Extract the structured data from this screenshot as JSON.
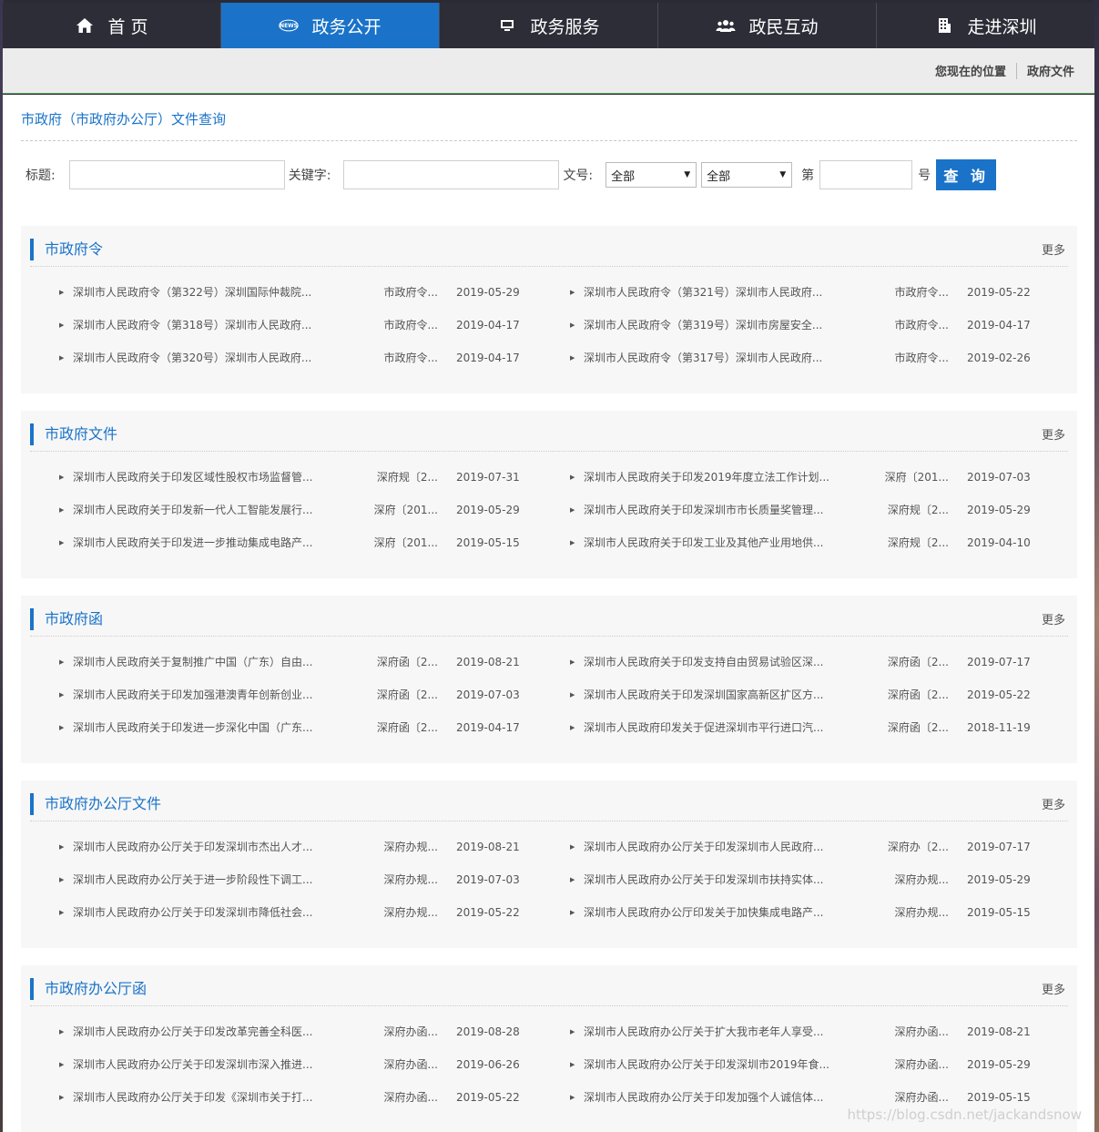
{
  "nav": {
    "items": [
      {
        "label": "首 页"
      },
      {
        "label": "政务公开"
      },
      {
        "label": "政务服务"
      },
      {
        "label": "政民互动"
      },
      {
        "label": "走进深圳"
      }
    ],
    "news_badge": "NEWS"
  },
  "breadcrumb": {
    "prefix": "您现在的位置",
    "current": "政府文件"
  },
  "query": {
    "title": "市政府（市政府办公厅）文件查询",
    "title_label": "标题:",
    "keyword_label": "关键字:",
    "docno_label": "文号:",
    "select1": "全部",
    "select2": "全部",
    "di_label": "第",
    "hao_label": "号",
    "button": "查 询"
  },
  "more_label": "更多",
  "sections": [
    {
      "title": "市政府令",
      "rows": [
        [
          {
            "t": "深圳市人民政府令（第322号）深圳国际仲裁院...",
            "n": "市政府令...",
            "d": "2019-05-29"
          },
          {
            "t": "深圳市人民政府令（第321号）深圳市人民政府...",
            "n": "市政府令...",
            "d": "2019-05-22"
          }
        ],
        [
          {
            "t": "深圳市人民政府令（第318号）深圳市人民政府...",
            "n": "市政府令...",
            "d": "2019-04-17"
          },
          {
            "t": "深圳市人民政府令（第319号）深圳市房屋安全...",
            "n": "市政府令...",
            "d": "2019-04-17"
          }
        ],
        [
          {
            "t": "深圳市人民政府令（第320号）深圳市人民政府...",
            "n": "市政府令...",
            "d": "2019-04-17"
          },
          {
            "t": "深圳市人民政府令（第317号）深圳市人民政府...",
            "n": "市政府令...",
            "d": "2019-02-26"
          }
        ]
      ]
    },
    {
      "title": "市政府文件",
      "rows": [
        [
          {
            "t": "深圳市人民政府关于印发区域性股权市场监督管...",
            "n": "深府规〔2...",
            "d": "2019-07-31"
          },
          {
            "t": "深圳市人民政府关于印发2019年度立法工作计划...",
            "n": "深府〔201...",
            "d": "2019-07-03"
          }
        ],
        [
          {
            "t": "深圳市人民政府关于印发新一代人工智能发展行...",
            "n": "深府〔201...",
            "d": "2019-05-29"
          },
          {
            "t": "深圳市人民政府关于印发深圳市市长质量奖管理...",
            "n": "深府规〔2...",
            "d": "2019-05-29"
          }
        ],
        [
          {
            "t": "深圳市人民政府关于印发进一步推动集成电路产...",
            "n": "深府〔201...",
            "d": "2019-05-15"
          },
          {
            "t": "深圳市人民政府关于印发工业及其他产业用地供...",
            "n": "深府规〔2...",
            "d": "2019-04-10"
          }
        ]
      ]
    },
    {
      "title": "市政府函",
      "rows": [
        [
          {
            "t": "深圳市人民政府关于复制推广中国（广东）自由...",
            "n": "深府函〔2...",
            "d": "2019-08-21"
          },
          {
            "t": "深圳市人民政府关于印发支持自由贸易试验区深...",
            "n": "深府函〔2...",
            "d": "2019-07-17"
          }
        ],
        [
          {
            "t": "深圳市人民政府关于印发加强港澳青年创新创业...",
            "n": "深府函〔2...",
            "d": "2019-07-03"
          },
          {
            "t": "深圳市人民政府关于印发深圳国家高新区扩区方...",
            "n": "深府函〔2...",
            "d": "2019-05-22"
          }
        ],
        [
          {
            "t": "深圳市人民政府关于印发进一步深化中国（广东...",
            "n": "深府函〔2...",
            "d": "2019-04-17"
          },
          {
            "t": "深圳市人民政府印发关于促进深圳市平行进口汽...",
            "n": "深府函〔2...",
            "d": "2018-11-19"
          }
        ]
      ]
    },
    {
      "title": "市政府办公厅文件",
      "rows": [
        [
          {
            "t": "深圳市人民政府办公厅关于印发深圳市杰出人才...",
            "n": "深府办规...",
            "d": "2019-08-21"
          },
          {
            "t": "深圳市人民政府办公厅关于印发深圳市人民政府...",
            "n": "深府办〔2...",
            "d": "2019-07-17"
          }
        ],
        [
          {
            "t": "深圳市人民政府办公厅关于进一步阶段性下调工...",
            "n": "深府办规...",
            "d": "2019-07-03"
          },
          {
            "t": "深圳市人民政府办公厅关于印发深圳市扶持实体...",
            "n": "深府办规...",
            "d": "2019-05-29"
          }
        ],
        [
          {
            "t": "深圳市人民政府办公厅关于印发深圳市降低社会...",
            "n": "深府办规...",
            "d": "2019-05-22"
          },
          {
            "t": "深圳市人民政府办公厅印发关于加快集成电路产...",
            "n": "深府办规...",
            "d": "2019-05-15"
          }
        ]
      ]
    },
    {
      "title": "市政府办公厅函",
      "rows": [
        [
          {
            "t": "深圳市人民政府办公厅关于印发改革完善全科医...",
            "n": "深府办函...",
            "d": "2019-08-28"
          },
          {
            "t": "深圳市人民政府办公厅关于扩大我市老年人享受...",
            "n": "深府办函...",
            "d": "2019-08-21"
          }
        ],
        [
          {
            "t": "深圳市人民政府办公厅关于印发深圳市深入推进...",
            "n": "深府办函...",
            "d": "2019-06-26"
          },
          {
            "t": "深圳市人民政府办公厅关于印发深圳市2019年食...",
            "n": "深府办函...",
            "d": "2019-05-29"
          }
        ],
        [
          {
            "t": "深圳市人民政府办公厅关于印发《深圳市关于打...",
            "n": "深府办函...",
            "d": "2019-05-22"
          },
          {
            "t": "深圳市人民政府办公厅关于印发加强个人诚信体...",
            "n": "深府办函...",
            "d": "2019-05-15"
          }
        ]
      ]
    }
  ],
  "watermark": "https://blog.csdn.net/jackandsnow"
}
